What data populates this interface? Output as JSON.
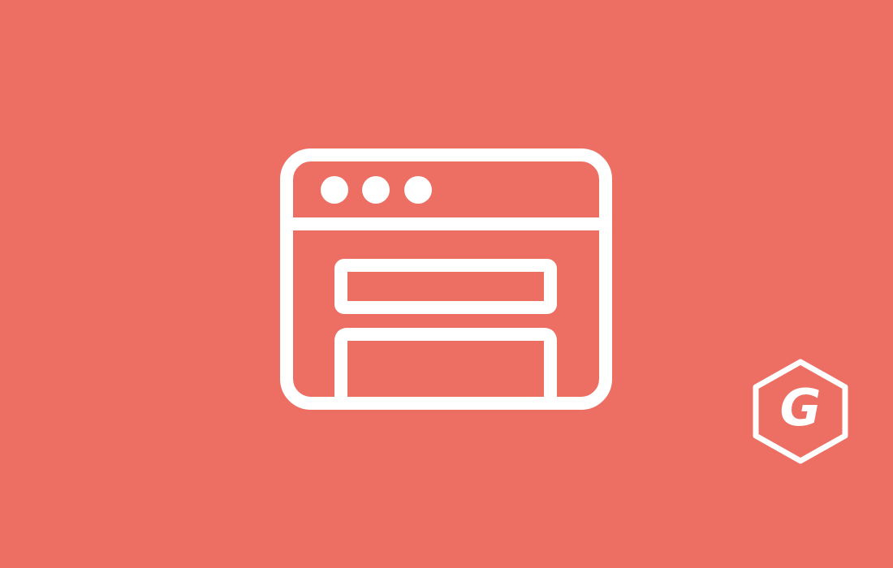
{
  "colors": {
    "background": "#ED6F63",
    "foreground": "#FFFFFF"
  },
  "icons": {
    "main": "browser-window-form-icon",
    "logo": "gravity-forms-logo-icon"
  },
  "logo": {
    "letter": "G"
  }
}
